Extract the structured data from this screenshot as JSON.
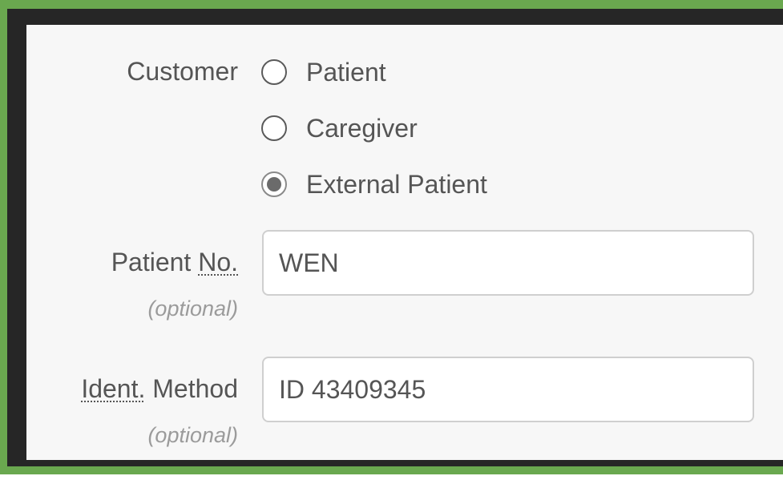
{
  "form": {
    "customer_label": "Customer",
    "customer_options": [
      {
        "label": "Patient",
        "checked": false
      },
      {
        "label": "Caregiver",
        "checked": false
      },
      {
        "label": "External Patient",
        "checked": true
      }
    ],
    "patient_no": {
      "label_prefix": "Patient ",
      "label_abbr": "No.",
      "hint": "(optional)",
      "value": "WEN"
    },
    "ident_method": {
      "label_abbr": "Ident.",
      "label_suffix": " Method",
      "hint": "(optional)",
      "value": "ID 43409345"
    }
  }
}
